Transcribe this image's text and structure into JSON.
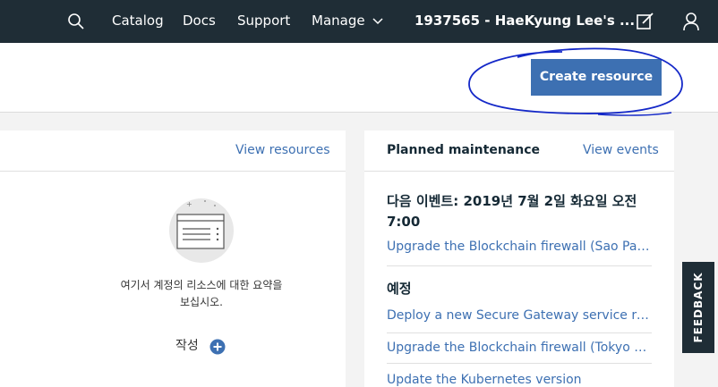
{
  "topbar": {
    "nav": [
      "Catalog",
      "Docs",
      "Support",
      "Manage"
    ],
    "account": "1937565 - HaeKyung Lee's ..."
  },
  "header": {
    "create_button": "Create resource"
  },
  "resources_card": {
    "view_link": "View resources",
    "empty_text_line1": "여기서 계정의 리소스에 대한 요약을",
    "empty_text_line2": "보십시오.",
    "create_label": "작성"
  },
  "maintenance_card": {
    "title": "Planned maintenance",
    "view_link": "View events",
    "next_event": "다음 이벤트: 2019년 7월 2일 화요일 오전 7:00",
    "next_event_item": "Upgrade the Blockchain firewall (Sao Paulo...",
    "scheduled_title": "예정",
    "scheduled_items": [
      "Deploy a new Secure Gateway service rele...",
      "Upgrade the Blockchain firewall (Tokyo dat...",
      "Update the Kubernetes version"
    ]
  },
  "feedback": {
    "label": "FEEDBACK"
  },
  "colors": {
    "topbar": "#1f2d36",
    "accent": "#3d70b2",
    "annotation": "#1428c8"
  }
}
